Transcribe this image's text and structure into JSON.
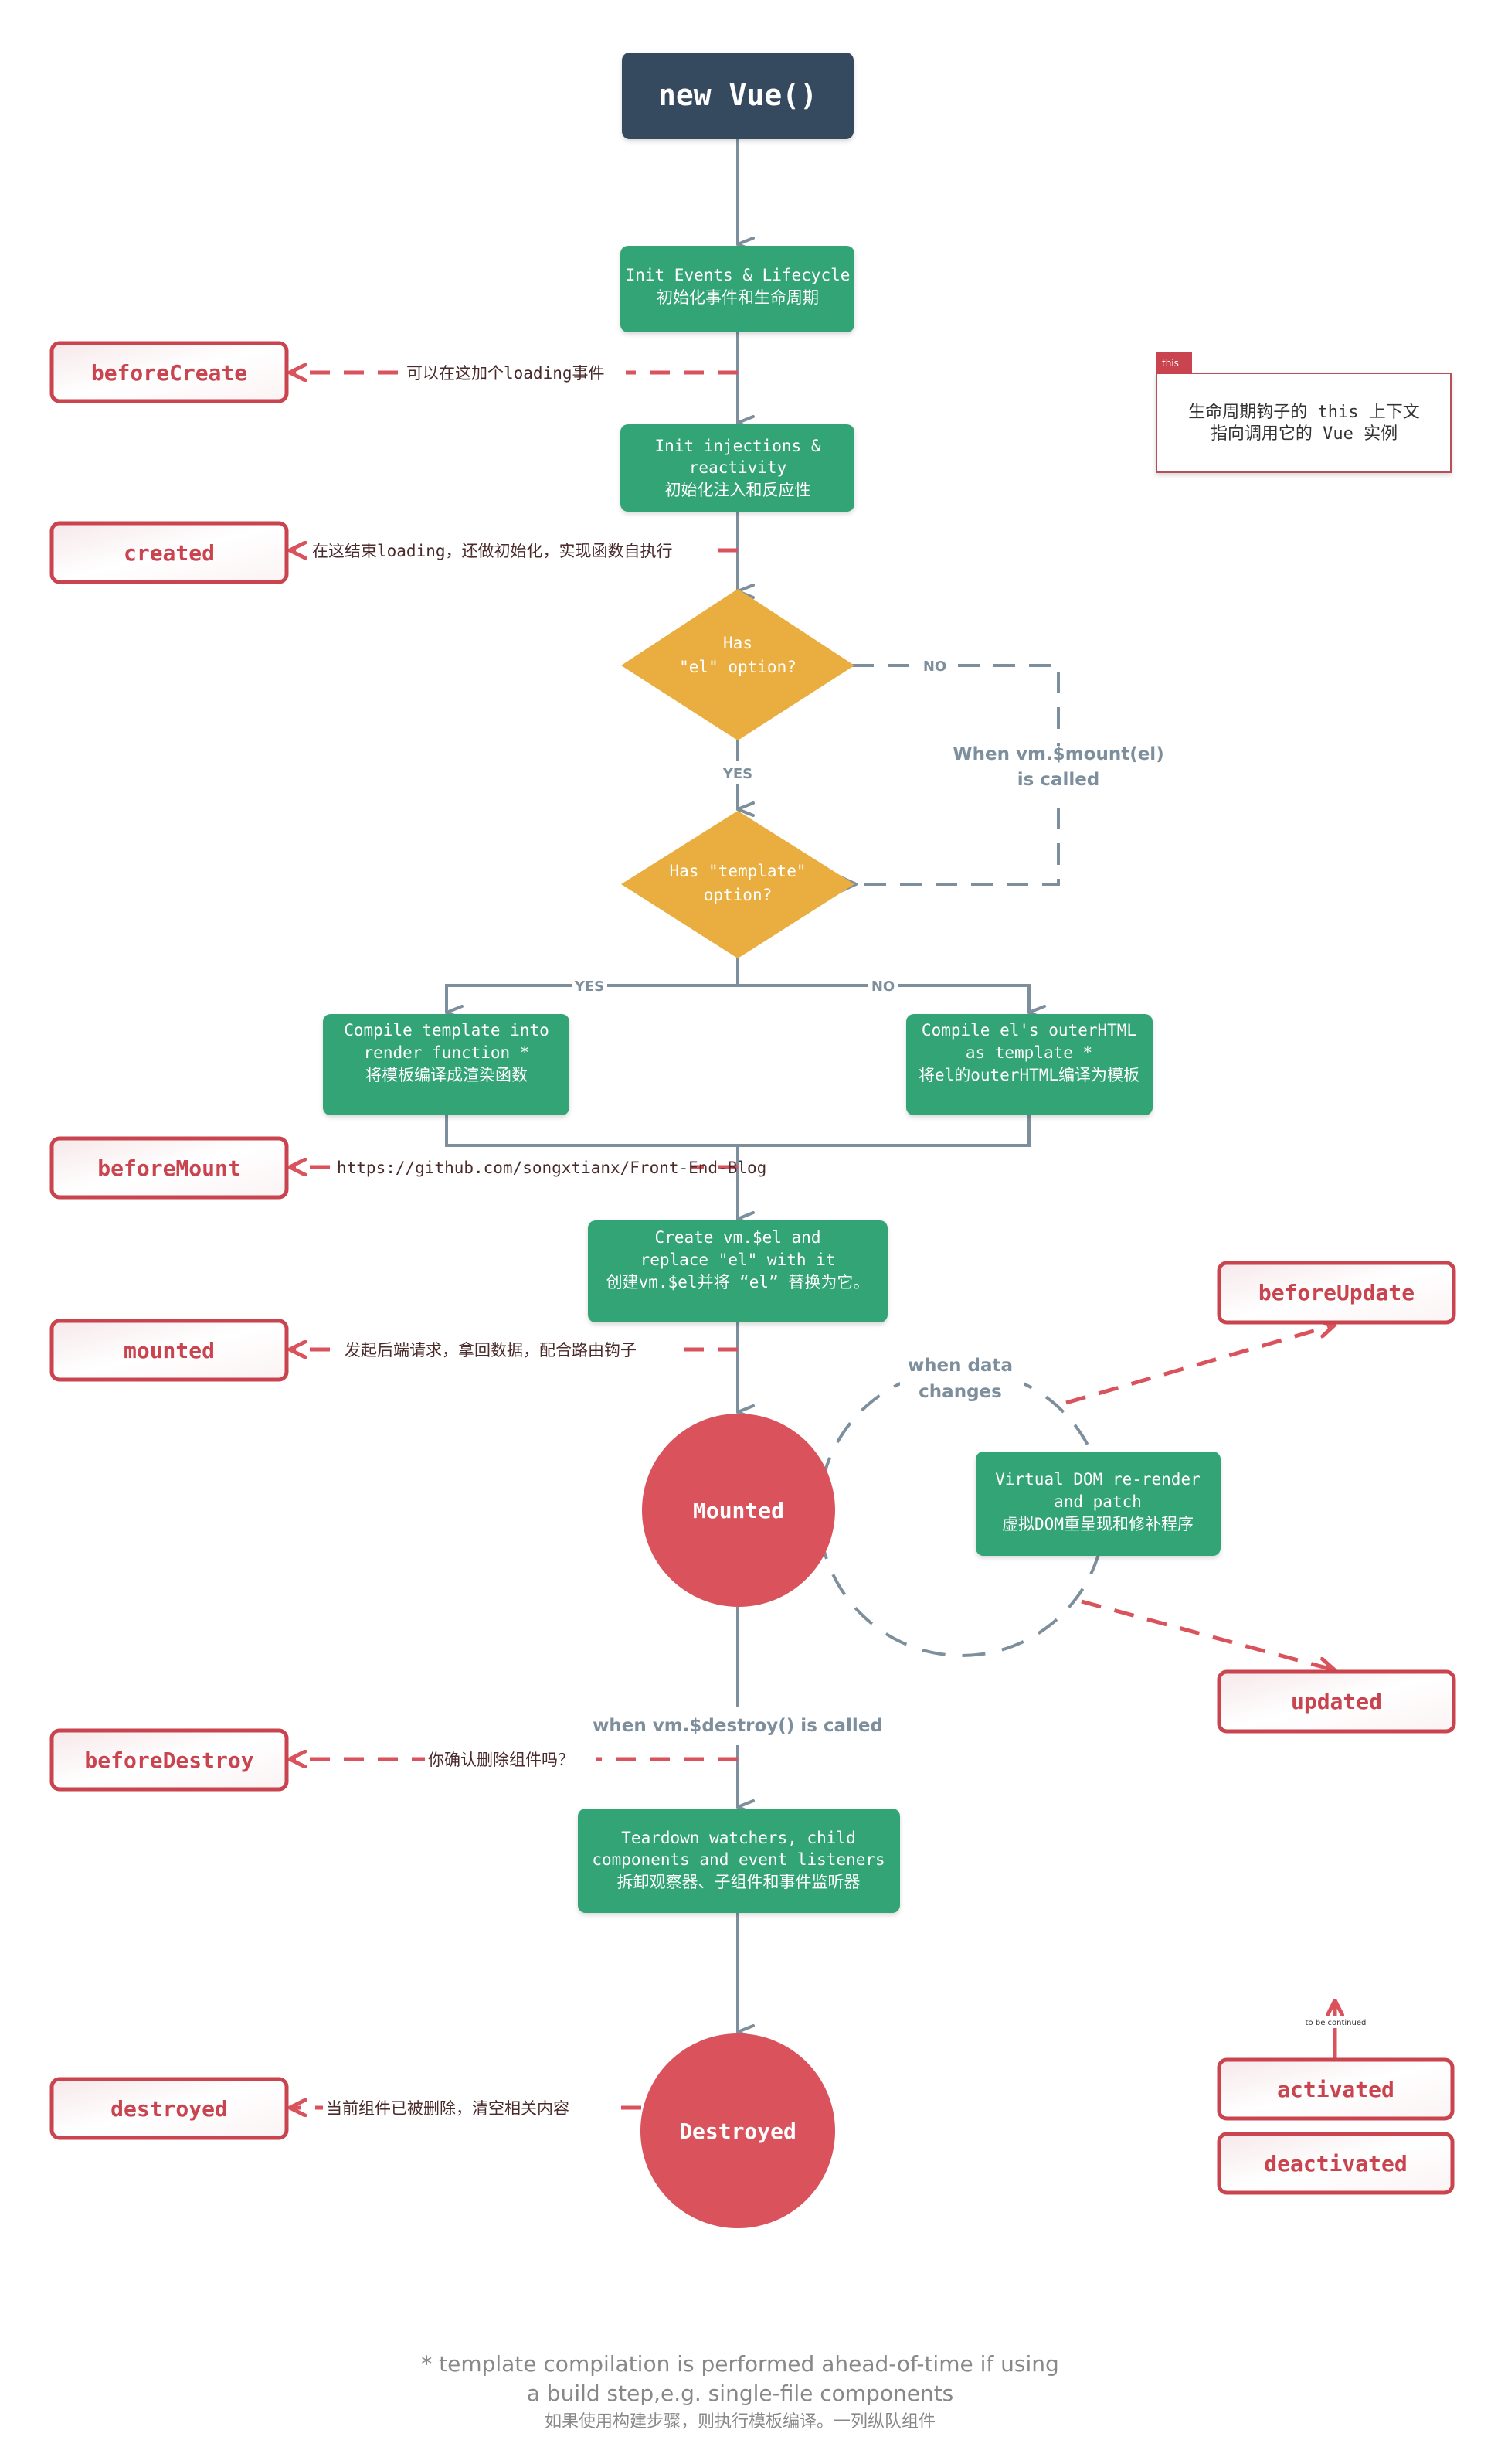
{
  "diagram": {
    "title": "Vue Lifecycle Diagram",
    "colors": {
      "start": "#35495e",
      "process": "#33a474",
      "decision": "#e9ae3f",
      "state": "#d9525c",
      "hook_border": "#c9444f",
      "flow_line": "#7d8f9c",
      "hook_line": "#d9525c"
    },
    "start": {
      "label": "new Vue()"
    },
    "steps": {
      "init_events": {
        "en": "Init Events & Lifecycle",
        "zh": "初始化事件和生命周期"
      },
      "init_injections": {
        "en1": "Init injections &",
        "en2": "reactivity",
        "zh": "初始化注入和反应性"
      },
      "compile_template": {
        "en1": "Compile template into",
        "en2": "render function *",
        "zh": "将模板编译成渲染函数"
      },
      "compile_el": {
        "en1": "Compile el's outerHTML",
        "en2": "as template *",
        "zh": "将el的outerHTML编译为模板"
      },
      "create_el": {
        "en1": "Create vm.$el and",
        "en2": "replace \"el\" with it",
        "zh": "创建vm.$el并将 “el” 替换为它。"
      },
      "vdom": {
        "en1": "Virtual DOM re-render",
        "en2": "and patch",
        "zh": "虚拟DOM重呈现和修补程序"
      },
      "teardown": {
        "en1": "Teardown watchers, child",
        "en2": "components and event listeners",
        "zh": "拆卸观察器、子组件和事件监听器"
      }
    },
    "decisions": {
      "has_el": {
        "line1": "Has",
        "line2": "\"el\" option?"
      },
      "has_template": {
        "line1": "Has \"template\"",
        "line2": "option?"
      }
    },
    "branch_labels": {
      "el_no": "NO",
      "el_yes": "YES",
      "template_yes": "YES",
      "template_no": "NO",
      "mount_called_1": "When vm.$mount(el)",
      "mount_called_2": "is called",
      "data_changes_1": "when data",
      "data_changes_2": "changes",
      "destroy_called": "when vm.$destroy() is called"
    },
    "states": {
      "mounted": "Mounted",
      "destroyed": "Destroyed"
    },
    "hooks": {
      "beforeCreate": {
        "label": "beforeCreate",
        "note": "可以在这加个loading事件"
      },
      "created": {
        "label": "created",
        "note": "在这结束loading，还做初始化，实现函数自执行"
      },
      "beforeMount": {
        "label": "beforeMount",
        "note": "https://github.com/songxtianx/Front-End-Blog"
      },
      "mounted": {
        "label": "mounted",
        "note": "发起后端请求，拿回数据，配合路由钩子"
      },
      "beforeUpdate": {
        "label": "beforeUpdate"
      },
      "updated": {
        "label": "updated"
      },
      "beforeDestroy": {
        "label": "beforeDestroy",
        "note": "你确认删除组件吗？"
      },
      "destroyed": {
        "label": "destroyed",
        "note": "当前组件已被删除，清空相关内容"
      },
      "activated": {
        "label": "activated",
        "note": "to be continued"
      },
      "deactivated": {
        "label": "deactivated"
      }
    },
    "this_note": {
      "tag": "this",
      "line1": "生命周期钩子的 this 上下文",
      "line2": "指向调用它的 Vue 实例"
    },
    "footer": {
      "line1": "* template compilation is performed ahead-of-time if using",
      "line2": "a build step,e.g. single-file components",
      "line3": "如果使用构建步骤，则执行模板编译。一列纵队组件"
    }
  }
}
